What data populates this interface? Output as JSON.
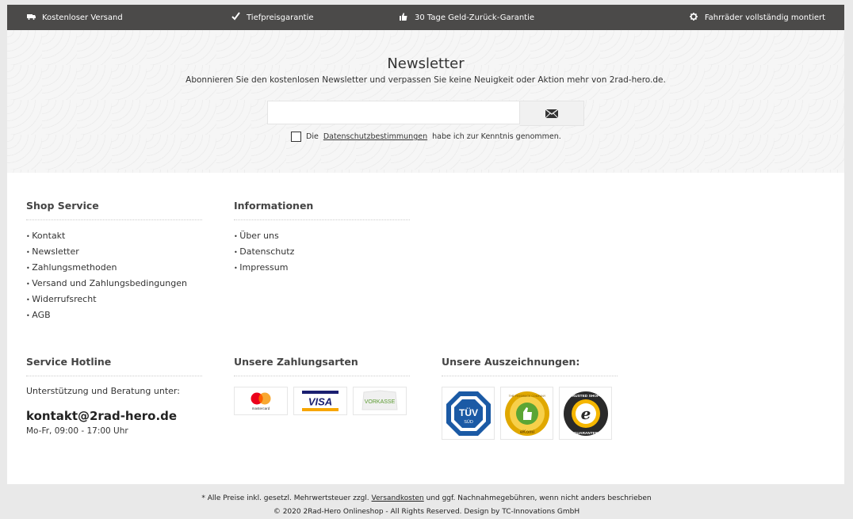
{
  "topbar": {
    "items": [
      {
        "icon": "truck-icon",
        "label": "Kostenloser Versand"
      },
      {
        "icon": "checkmark-icon",
        "label": "Tiefpreisgarantie"
      },
      {
        "icon": "thumbs-up-icon",
        "label": "30 Tage Geld-Zurück-Garantie"
      },
      {
        "icon": "gear-icon",
        "label": "Fahrräder vollständig montiert"
      }
    ]
  },
  "newsletter": {
    "title": "Newsletter",
    "subtitle": "Abonnieren Sie den kostenlosen Newsletter und verpassen Sie keine Neuigkeit oder Aktion mehr von 2rad-hero.de.",
    "email_value": "",
    "submit_icon": "envelope-icon",
    "consent_prefix": "Die",
    "consent_link": "Datenschutzbestimmungen",
    "consent_suffix": "habe ich zur Kenntnis genommen."
  },
  "footer": {
    "shop_service": {
      "title": "Shop Service",
      "links": [
        "Kontakt",
        "Newsletter",
        "Zahlungsmethoden",
        "Versand und Zahlungsbedingungen",
        "Widerrufsrecht",
        "AGB"
      ]
    },
    "informationen": {
      "title": "Informationen",
      "links": [
        "Über uns",
        "Datenschutz",
        "Impressum"
      ]
    },
    "hotline": {
      "title": "Service Hotline",
      "subtitle": "Unterstützung und Beratung unter:",
      "email": "kontakt@2rad-hero.de",
      "hours": "Mo-Fr, 09:00 - 17:00 Uhr"
    },
    "payments": {
      "title": "Unsere Zahlungsarten",
      "methods": [
        {
          "name": "mastercard",
          "label": "mastercard"
        },
        {
          "name": "visa",
          "label": "VISA"
        },
        {
          "name": "vorkasse",
          "label": "VORKASSE"
        }
      ]
    },
    "awards": {
      "title": "Unsere Auszeichnungen:",
      "badges": [
        {
          "name": "tuv-sud",
          "label": "TÜV",
          "sub": "SÜD"
        },
        {
          "name": "ekomi",
          "label": "THE FEEDBACK COMPANY",
          "sub": "eKomi"
        },
        {
          "name": "trusted-shops",
          "label": "TRUSTED SHOPS",
          "sub": "GUARANTEE"
        }
      ]
    }
  },
  "legal": {
    "line1_prefix": "* Alle Preise inkl. gesetzl. Mehrwertsteuer zzgl.",
    "line1_link": "Versandkosten",
    "line1_suffix": "und ggf. Nachnahmegebühren, wenn nicht anders beschrieben",
    "line2": "© 2020 2Rad-Hero Onlineshop - All Rights Reserved. Design by TC-Innovations GmbH"
  },
  "colors": {
    "topbar_bg": "#4b4a49",
    "page_bg": "#e9e9e9",
    "visa_blue": "#1a1f71",
    "visa_gold": "#f7a600",
    "vorkasse_green": "#5a9a2f"
  }
}
